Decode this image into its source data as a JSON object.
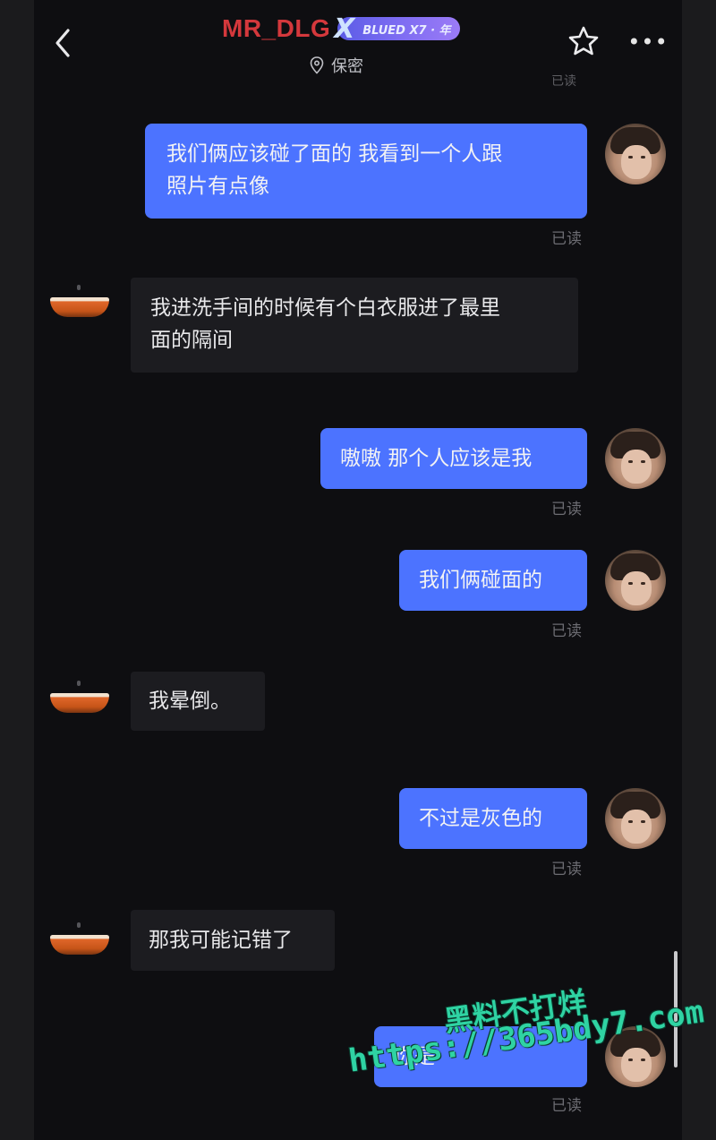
{
  "header": {
    "title": "MR_DLG",
    "badge_label": "BLUED X7 · 年",
    "location": "保密",
    "top_read_status": "已读"
  },
  "messages": [
    {
      "side": "me",
      "text_line1": "我们俩应该碰了面的 我看到一个人跟",
      "text_line2": "照片有点像",
      "status": "已读"
    },
    {
      "side": "them",
      "text_line1": "我进洗手间的时候有个白衣服进了最里",
      "text_line2": "面的隔间"
    },
    {
      "side": "me",
      "text": "嗷嗷 那个人应该是我",
      "status": "已读"
    },
    {
      "side": "me",
      "text": "我们俩碰面的",
      "status": "已读"
    },
    {
      "side": "them",
      "text": "我晕倒。"
    },
    {
      "side": "me",
      "text": "不过是灰色的",
      "status": "已读"
    },
    {
      "side": "them",
      "text": "那我可能记错了"
    },
    {
      "side": "me",
      "text": "你是",
      "status": "已读"
    }
  ],
  "watermark": {
    "line1": "黑料不打烊",
    "line2": "https://365bdy7.com",
    "color": "#2fd3a3"
  },
  "colors": {
    "my_bubble": "#4c73ff",
    "their_bubble": "#1c1c20",
    "title": "#d4383c",
    "background": "#0e0e11"
  }
}
